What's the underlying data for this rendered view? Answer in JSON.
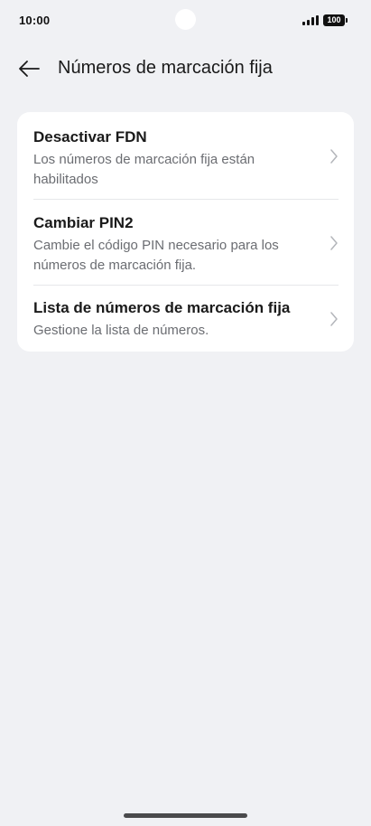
{
  "status_bar": {
    "time": "10:00",
    "battery": "100",
    "icons": [
      "signal-icon",
      "battery-icon"
    ]
  },
  "header": {
    "back_icon": "back-arrow-icon",
    "title": "Números de marcación fija"
  },
  "settings": {
    "items": [
      {
        "title": "Desactivar FDN",
        "subtitle": "Los números de marcación fija están habilitados",
        "icon": "chevron-right-icon"
      },
      {
        "title": "Cambiar PIN2",
        "subtitle": "Cambie el código PIN necesario para los números de marcación fija.",
        "icon": "chevron-right-icon"
      },
      {
        "title": "Lista de números de marcación fija",
        "subtitle": "Gestione la lista de números.",
        "icon": "chevron-right-icon"
      }
    ]
  },
  "colors": {
    "background": "#f0f1f4",
    "card": "#ffffff",
    "title_text": "#1a1a1a",
    "subtitle_text": "#6b6d72",
    "chevron": "#b3b5ba"
  }
}
